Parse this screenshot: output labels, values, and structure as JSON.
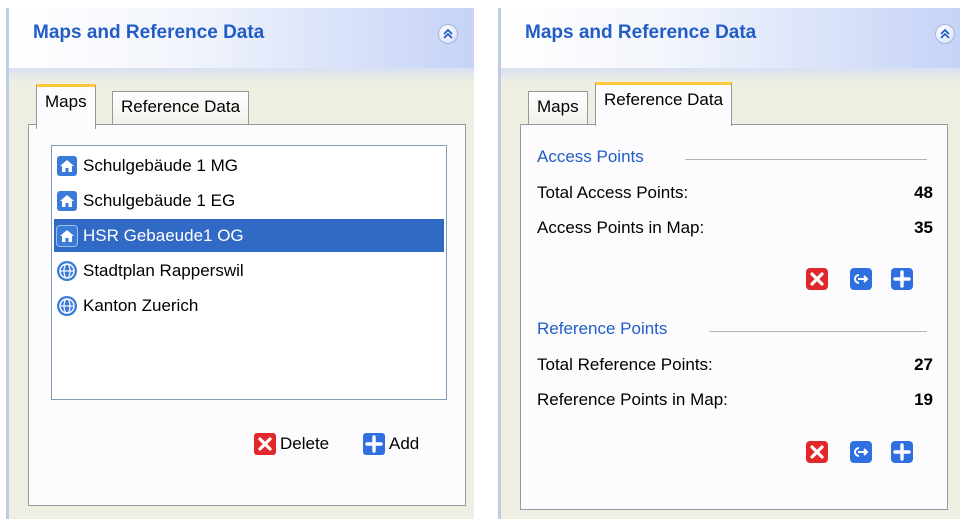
{
  "left_panel": {
    "title": "Maps and Reference Data",
    "tabs": [
      {
        "label": "Maps",
        "active": true
      },
      {
        "label": "Reference Data",
        "active": false
      }
    ],
    "maps": [
      {
        "name": "Schulgebäude 1 MG",
        "icon": "home-icon",
        "selected": false
      },
      {
        "name": "Schulgebäude 1 EG",
        "icon": "home-icon",
        "selected": false
      },
      {
        "name": "HSR Gebaeude1 OG",
        "icon": "home-icon",
        "selected": true
      },
      {
        "name": "Stadtplan Rapperswil",
        "icon": "globe-icon",
        "selected": false
      },
      {
        "name": "Kanton Zuerich",
        "icon": "globe-icon",
        "selected": false
      }
    ],
    "delete_label": "Delete",
    "add_label": "Add"
  },
  "right_panel": {
    "title": "Maps and Reference Data",
    "tabs": [
      {
        "label": "Maps",
        "active": false
      },
      {
        "label": "Reference Data",
        "active": true
      }
    ],
    "access_points": {
      "title": "Access Points",
      "total_label": "Total Access Points:",
      "total_value": "48",
      "in_map_label": "Access Points in Map:",
      "in_map_value": "35"
    },
    "reference_points": {
      "title": "Reference Points",
      "total_label": "Total Reference Points:",
      "total_value": "27",
      "in_map_label": "Reference Points in Map:",
      "in_map_value": "19"
    },
    "action_icons": [
      "delete-icon",
      "export-icon",
      "add-icon"
    ]
  },
  "colors": {
    "title_blue": "#215dc6",
    "panel_bg": "#eeeee2",
    "selection": "#316ac5",
    "tab_highlight": "#ffc83c",
    "delete_red": "#e2272a",
    "button_blue": "#2f6fe0"
  }
}
